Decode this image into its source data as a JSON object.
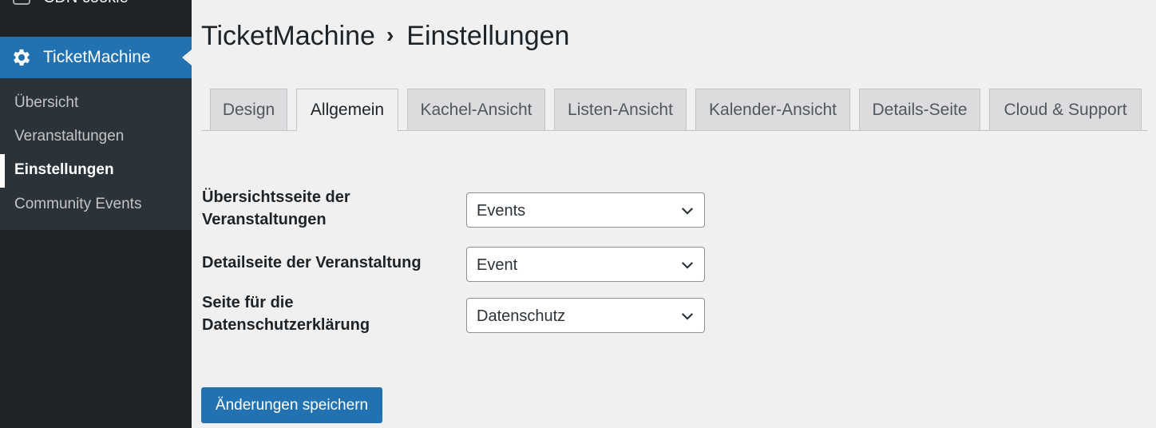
{
  "sidebar": {
    "top_item_label": "CDN cookie",
    "active_menu": {
      "label": "TicketMachine",
      "icon": "gear-icon"
    },
    "submenu": [
      {
        "label": "Übersicht",
        "current": false
      },
      {
        "label": "Veranstaltungen",
        "current": false
      },
      {
        "label": "Einstellungen",
        "current": true
      },
      {
        "label": "Community Events",
        "current": false
      }
    ]
  },
  "header": {
    "breadcrumb_root": "TicketMachine",
    "separator_icon": "chevron-right-icon",
    "breadcrumb_current": "Einstellungen"
  },
  "tabs": [
    {
      "label": "Design",
      "active": false
    },
    {
      "label": "Allgemein",
      "active": true
    },
    {
      "label": "Kachel-Ansicht",
      "active": false
    },
    {
      "label": "Listen-Ansicht",
      "active": false
    },
    {
      "label": "Kalender-Ansicht",
      "active": false
    },
    {
      "label": "Details-Seite",
      "active": false
    },
    {
      "label": "Cloud & Support",
      "active": false
    }
  ],
  "settings": {
    "overview_page": {
      "label": "Übersichtsseite der Veranstaltungen",
      "value": "Events"
    },
    "detail_page": {
      "label": "Detailseite der Veranstaltung",
      "value": "Event"
    },
    "privacy_page": {
      "label": "Seite für die Datenschutzerklärung",
      "value": "Datenschutz"
    }
  },
  "actions": {
    "save_label": "Änderungen speichern"
  },
  "colors": {
    "accent": "#2271b1",
    "sidebar_bg": "#1d2327",
    "submenu_bg": "#2c3338",
    "page_bg": "#f0f0f1"
  }
}
